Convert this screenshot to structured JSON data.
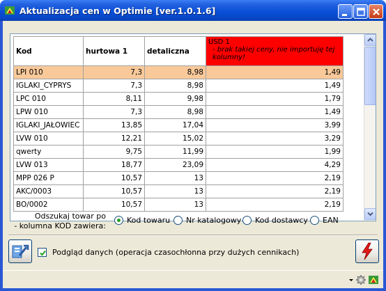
{
  "window": {
    "title": "Aktualizacja cen w Optimie [ver.1.0.1.6]"
  },
  "titlebar_buttons": {
    "minimize_icon": "minimize-icon",
    "maximize_icon": "maximize-icon",
    "close_icon": "close-icon"
  },
  "grid": {
    "columns": {
      "kod": "Kod",
      "hurtowa": "hurtowa 1",
      "detaliczna": "detaliczna",
      "usd_title": "USD 1",
      "usd_note": "- brak takiej ceny, nie importuję tej kolumny!"
    },
    "rows": [
      {
        "kod": "LPI 010",
        "hurtowa": "7,3",
        "detaliczna": "8,98",
        "usd": "1,49"
      },
      {
        "kod": "IGLAKI_CYPRYS",
        "hurtowa": "7,3",
        "detaliczna": "8,98",
        "usd": "1,49"
      },
      {
        "kod": "LPC 010",
        "hurtowa": "8,11",
        "detaliczna": "9,98",
        "usd": "1,79"
      },
      {
        "kod": "LPW 010",
        "hurtowa": "7,3",
        "detaliczna": "8,98",
        "usd": "1,49"
      },
      {
        "kod": "IGLAKI_JAŁOWIEC",
        "hurtowa": "13,85",
        "detaliczna": "17,04",
        "usd": "3,99"
      },
      {
        "kod": "LVW 010",
        "hurtowa": "12,21",
        "detaliczna": "15,02",
        "usd": "3,29"
      },
      {
        "kod": "qwerty",
        "hurtowa": "9,75",
        "detaliczna": "11,99",
        "usd": "1,99"
      },
      {
        "kod": "LVW 013",
        "hurtowa": "18,77",
        "detaliczna": "23,09",
        "usd": "4,29"
      },
      {
        "kod": "MPP 026 P",
        "hurtowa": "10,57",
        "detaliczna": "13",
        "usd": "2,19"
      },
      {
        "kod": "AKC/0003",
        "hurtowa": "10,57",
        "detaliczna": "13",
        "usd": "2,19"
      },
      {
        "kod": "BO/0002",
        "hurtowa": "10,57",
        "detaliczna": "13",
        "usd": "2,19"
      }
    ],
    "selected_row": 0
  },
  "search": {
    "label_line1": "Odszukaj towar po",
    "label_line2": "- kolumna KOD zawiera:",
    "options": [
      "Kod towaru",
      "Nr katalogowy",
      "Kod dostawcy",
      "EAN"
    ],
    "selected": "Kod towaru"
  },
  "preview": {
    "checkbox_label": "Podgląd danych (operacja czasochłonna przy dużych cennikach)",
    "checked": true
  },
  "colors": {
    "selected_row": "#f9c99a",
    "usd_header": "#ff0000",
    "titlebar": "#0a4fd6"
  }
}
